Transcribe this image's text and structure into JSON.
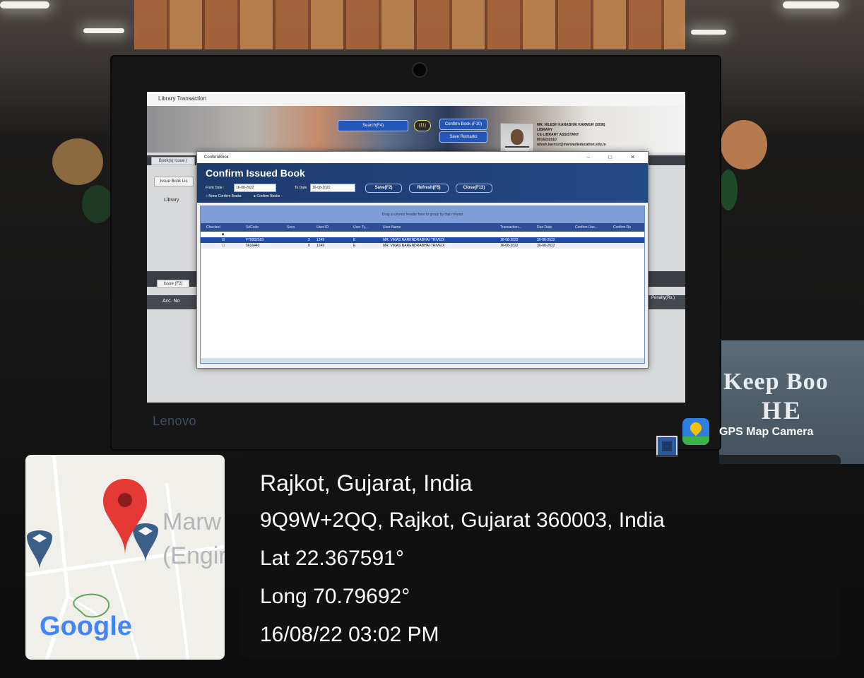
{
  "monitor": {
    "brand": "Lenovo",
    "window_title": "Library Transaction",
    "banner": {
      "search_button": "Search(F4)",
      "count_badge": "(11)",
      "confirm_button": "Confirm Book (F10)",
      "save_remark_button": "Save Remarks",
      "librarian": [
        "MR. NILESH KANABHAI KARMUR (1038)",
        "LIBRARY",
        "CE LIBRARY ASSISTANT",
        "8016232510",
        "nilesh.karmur@marwadieducation.edu.in"
      ]
    },
    "sidebar": {
      "tab": "Book(s) Issue (",
      "issue_list_button": "Issue Book Lis",
      "library_label": "Library",
      "issue_button": "Issue (F2)",
      "acc_no_label": "Acc. No",
      "penalty_label": "Penalty(Rs.)"
    },
    "dialog": {
      "window_title": "ConfirmBook",
      "heading": "Confirm Issued Book",
      "from_date_label": "From Date :",
      "from_date": "16-08-2022",
      "to_date_label": "To Date",
      "to_date": "16-08-2022",
      "save_button": "Save(F2)",
      "refresh_button": "Refresh(F5)",
      "close_button": "Close(F12)",
      "radio_none": "None Confirm Books",
      "radio_confirm": "Confirm Books",
      "group_hint": "Drag a column header here to group by that column",
      "columns": [
        "Checked",
        "SrlCode",
        "Sees",
        "User ID",
        "User Ty...",
        "User Name",
        "Transaction...",
        "Due Date",
        "Confirm Use...",
        "Confirm Rs"
      ],
      "rows": [
        {
          "srlcode": "F70002503",
          "sees": "2",
          "user_id": "1249",
          "user_type": "E",
          "user_name": "MR. VIKAS NARENDRABHAI TRIVEDI",
          "transaction": "16-08-2022",
          "due_date": "30-08-2022"
        },
        {
          "srlcode": "5616440",
          "sees": "0",
          "user_id": "1249",
          "user_type": "E",
          "user_name": "MR. VIKAS NARENDRABHAI TRIVEDI",
          "transaction": "16-08-2022",
          "due_date": "30-08-2022"
        }
      ]
    }
  },
  "background": {
    "sign_line1": "Keep Boo",
    "sign_line2": "HE"
  },
  "overlay": {
    "app_label": "GPS Map Camera",
    "city": "Rajkot, Gujarat, India",
    "address": "9Q9W+2QQ, Rajkot, Gujarat 360003, India",
    "lat": "Lat 22.367591°",
    "long": "Long 70.79692°",
    "datetime": "16/08/22 03:02 PM",
    "map_place_line1": "Marw",
    "map_place_line2": "(Engir",
    "map_brand": "Google"
  },
  "colors": {
    "overlay_text": "#ffffff",
    "dialog_header": "#244a86",
    "map_pin": "#e53935",
    "google_blue": "#4285f4"
  }
}
